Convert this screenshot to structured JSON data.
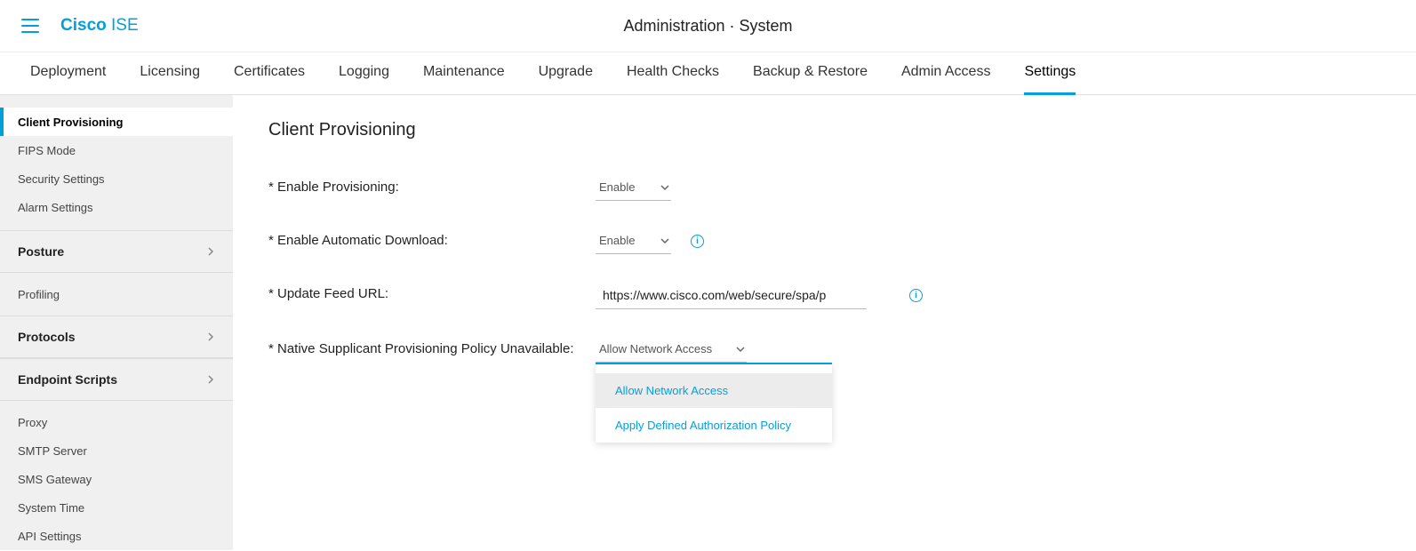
{
  "header": {
    "logo_bold": "Cisco",
    "logo_rest": " ISE",
    "breadcrumb": "Administration · System"
  },
  "tabs": {
    "items": [
      {
        "label": "Deployment"
      },
      {
        "label": "Licensing"
      },
      {
        "label": "Certificates"
      },
      {
        "label": "Logging"
      },
      {
        "label": "Maintenance"
      },
      {
        "label": "Upgrade"
      },
      {
        "label": "Health Checks"
      },
      {
        "label": "Backup & Restore"
      },
      {
        "label": "Admin Access"
      },
      {
        "label": "Settings"
      }
    ]
  },
  "sidebar": {
    "items": [
      {
        "label": "Client Provisioning",
        "active": true
      },
      {
        "label": "FIPS Mode"
      },
      {
        "label": "Security Settings"
      },
      {
        "label": "Alarm Settings"
      }
    ],
    "groups": [
      {
        "label": "Posture"
      }
    ],
    "items2": [
      {
        "label": "Profiling"
      }
    ],
    "groups2": [
      {
        "label": "Protocols"
      },
      {
        "label": "Endpoint Scripts"
      }
    ],
    "items3": [
      {
        "label": "Proxy"
      },
      {
        "label": "SMTP Server"
      },
      {
        "label": "SMS Gateway"
      },
      {
        "label": "System Time"
      },
      {
        "label": "API Settings"
      }
    ]
  },
  "content": {
    "title": "Client Provisioning",
    "rows": {
      "enable_provisioning": {
        "label": "* Enable Provisioning:",
        "value": "Enable"
      },
      "enable_auto": {
        "label": "* Enable Automatic Download:",
        "value": "Enable"
      },
      "feed_url": {
        "label": "* Update Feed URL:",
        "value": "https://www.cisco.com/web/secure/spa/p"
      },
      "native_policy": {
        "label": "* Native Supplicant Provisioning Policy Unavailable:",
        "value": "Allow Network Access"
      }
    },
    "dropdown": {
      "opt1": "Allow Network Access",
      "opt2": "Apply Defined Authorization Policy"
    }
  }
}
